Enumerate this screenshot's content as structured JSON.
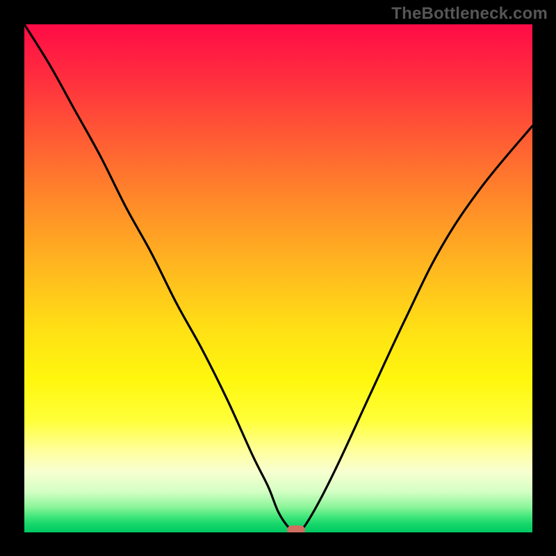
{
  "watermark": "TheBottleneck.com",
  "colors": {
    "frame": "#000000",
    "curve": "#000000",
    "marker": "#cf6f61",
    "watermark": "#565656"
  },
  "chart_data": {
    "type": "line",
    "title": "",
    "xlabel": "",
    "ylabel": "",
    "xlim": [
      0,
      100
    ],
    "ylim": [
      0,
      100
    ],
    "grid": false,
    "legend": false,
    "notes": "Background is a vertical gradient from red (high y) through orange/yellow to green (low y). A single black V-shaped curve reaches y≈0 near x≈53. A small rounded marker sits at the curve minimum.",
    "series": [
      {
        "name": "bottleneck-curve",
        "x": [
          0,
          5,
          10,
          15,
          20,
          25,
          30,
          35,
          40,
          45,
          48,
          50,
          52,
          53.5,
          55,
          58,
          62,
          68,
          75,
          82,
          90,
          100
        ],
        "y": [
          100,
          92,
          83,
          74,
          64,
          55,
          45,
          36,
          26,
          15,
          9,
          4,
          1,
          0,
          1,
          6,
          14,
          27,
          42,
          56,
          68,
          80
        ]
      }
    ],
    "marker": {
      "x": 53.5,
      "y": 0
    }
  }
}
